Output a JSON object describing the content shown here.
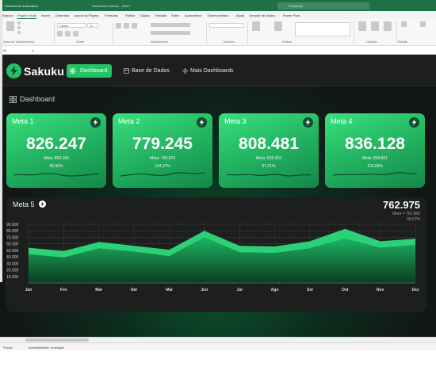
{
  "excel": {
    "autosave_label": "Salvamento Automático",
    "doc_title": "Dashboard Sakuku - Salvo",
    "search_placeholder": "Pesquisar",
    "menu_tabs": [
      "Arquivo",
      "Página Inicial",
      "Inserir",
      "Desenhar",
      "Layout da Página",
      "Fórmulas",
      "Python",
      "Dados",
      "Revisão",
      "Exibir",
      "Automatizar",
      "Desenvolvedor",
      "Ajuda",
      "Gerador de Dados",
      "Power Pivot"
    ],
    "ribbon_groups": [
      "Área de Transferência",
      "Fonte",
      "Alinhamento",
      "Número",
      "Estilos",
      "Células",
      "Edição"
    ],
    "font_name": "Calibri",
    "font_size": "11",
    "cell_ref": "A1",
    "fx_label": "fx",
    "status_left": "Pronto",
    "status_accessibility": "Acessibilidade: investigar"
  },
  "dashboard": {
    "brand": "Sakuku",
    "nav": [
      {
        "label": "Dashboard",
        "icon": "grid-icon",
        "active": true
      },
      {
        "label": "Base de Dados",
        "icon": "database-icon",
        "active": false
      },
      {
        "label": "Mais Dashboards",
        "icon": "sparkle-icon",
        "active": false
      }
    ],
    "section_title": "Dashboard",
    "colors": {
      "accent": "#22c265",
      "nav_bg": "#1d1f1e",
      "card_dark": "#1d1f1e"
    },
    "cards": [
      {
        "title": "Meta 1",
        "value": "826.247",
        "meta": "Meta: 862.166",
        "percent": "95,96%"
      },
      {
        "title": "Meta 2",
        "value": "779.245",
        "meta": "Meta: 740.623",
        "percent": "104,37%"
      },
      {
        "title": "Meta 3",
        "value": "808.481",
        "meta": "Meta: 833.416",
        "percent": "97,01%"
      },
      {
        "title": "Meta 4",
        "value": "836.128",
        "meta": "Meta: 804.831",
        "percent": "103,89%"
      }
    ],
    "big_card": {
      "title": "Meta 5",
      "value": "762.975",
      "meta": "Meta = 791.866",
      "percent": "95,67%"
    }
  },
  "chart_data": {
    "type": "area",
    "categories": [
      "Jan",
      "Fev",
      "Mar",
      "Abr",
      "Mai",
      "Jun",
      "Jul",
      "Ago",
      "Set",
      "Out",
      "Nov",
      "Dez"
    ],
    "y_ticks": [
      "-",
      "10.000",
      "20.000",
      "30.000",
      "40.000",
      "50.000",
      "60.000",
      "70.000",
      "80.000",
      "90.000"
    ],
    "ylim": [
      0,
      90000
    ],
    "series": [
      {
        "values": [
          54000,
          49000,
          63000,
          57000,
          51000,
          80000,
          57000,
          56000,
          64000,
          83000,
          64000,
          68000
        ]
      },
      {
        "values": [
          44000,
          39000,
          53000,
          48000,
          41000,
          70000,
          47000,
          46000,
          53000,
          68000,
          54000,
          58000
        ]
      }
    ]
  }
}
